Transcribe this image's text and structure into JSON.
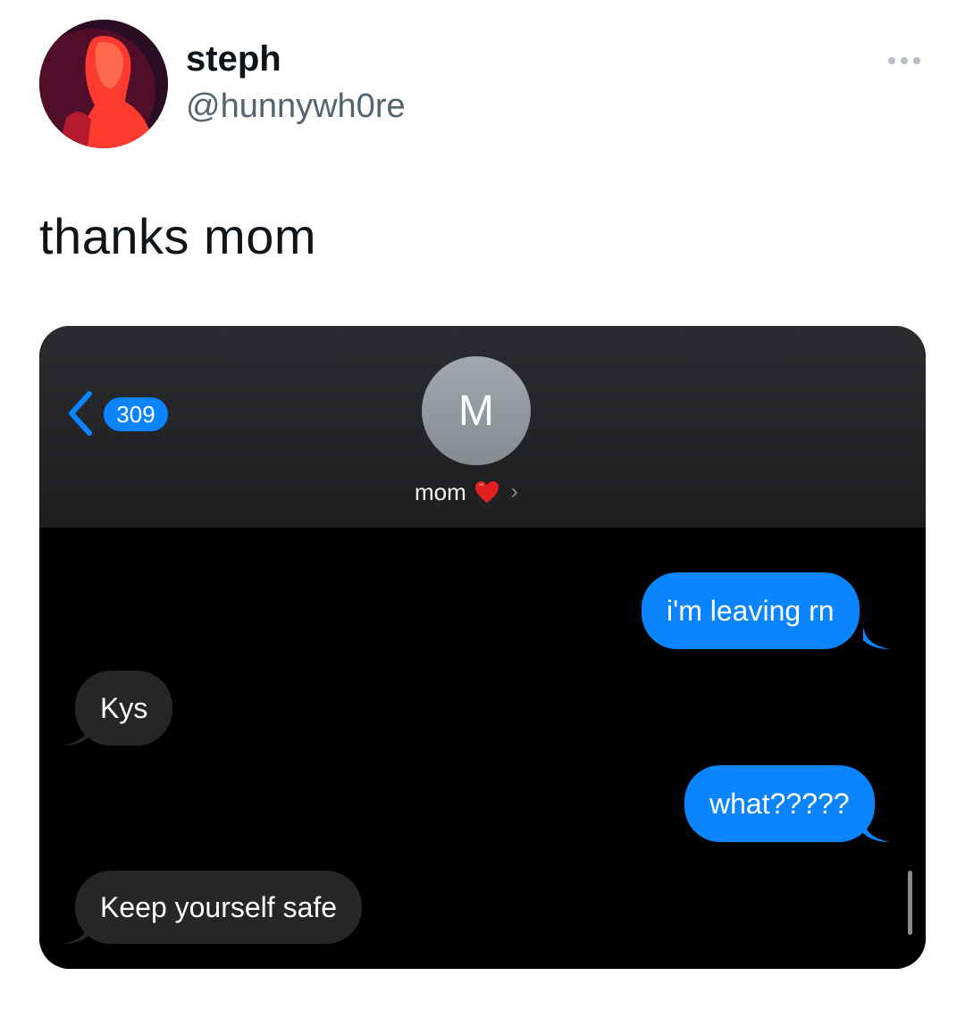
{
  "tweet": {
    "display_name": "steph",
    "handle": "@hunnywh0re",
    "text": "thanks mom",
    "more_icon": "more-dots-icon"
  },
  "screenshot": {
    "back_count": "309",
    "contact_initial": "M",
    "contact_name": "mom",
    "contact_emoji": "red-heart",
    "colors": {
      "sent_bubble": "#0a84ff",
      "received_bubble": "#262628",
      "header_bg": "#2b2c2f",
      "thread_bg": "#000000"
    },
    "messages": [
      {
        "sender": "me",
        "text": "i'm leaving rn"
      },
      {
        "sender": "mom",
        "text": "Kys"
      },
      {
        "sender": "me",
        "text": "what?????"
      },
      {
        "sender": "mom",
        "text": "Keep yourself safe"
      }
    ]
  }
}
